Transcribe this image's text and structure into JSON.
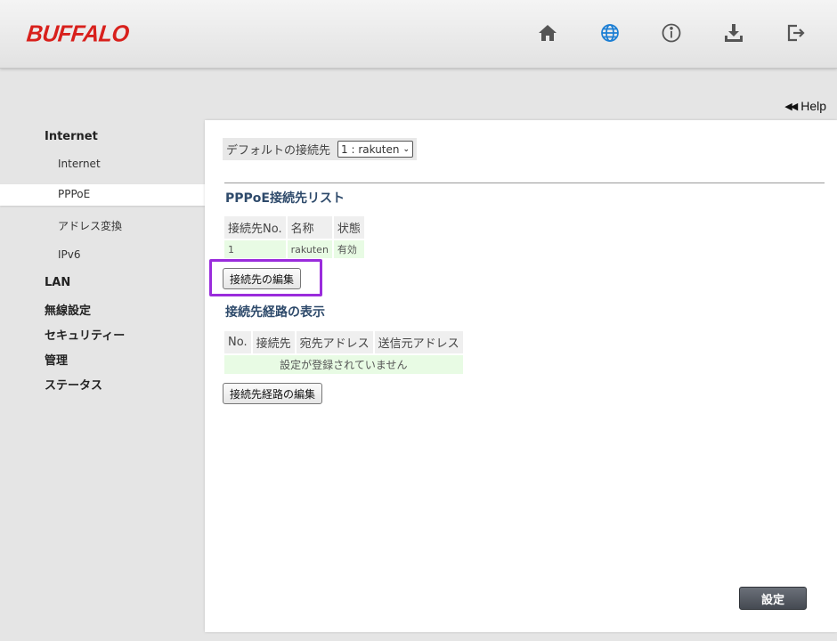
{
  "header": {
    "logo": "BUFFALO",
    "icons": [
      "home-icon",
      "globe-icon",
      "info-icon",
      "download-icon",
      "logout-icon"
    ]
  },
  "help": {
    "label": "Help"
  },
  "sidebar": {
    "sections": [
      {
        "label": "Internet",
        "items": [
          "Internet",
          "PPPoE",
          "アドレス変換",
          "IPv6"
        ]
      },
      {
        "label": "LAN"
      },
      {
        "label": "無線設定"
      },
      {
        "label": "セキュリティー"
      },
      {
        "label": "管理"
      },
      {
        "label": "ステータス"
      }
    ],
    "active_item": "PPPoE"
  },
  "main": {
    "default_label": "デフォルトの接続先",
    "default_value": "1 : rakuten",
    "pppoe_list_title": "PPPoE接続先リスト",
    "pppoe_table": {
      "headers": [
        "接続先No.",
        "名称",
        "状態"
      ],
      "rows": [
        [
          "1",
          "rakuten",
          "有効"
        ]
      ]
    },
    "edit_connection_button": "接続先の編集",
    "route_title": "接続先経路の表示",
    "route_table": {
      "headers": [
        "No.",
        "接続先",
        "宛先アドレス",
        "送信元アドレス"
      ],
      "empty_message": "設定が登録されていません"
    },
    "edit_route_button": "接続先経路の編集",
    "save_button": "設定"
  },
  "colors": {
    "brand": "#d8201c",
    "active_icon": "#1b7ed4",
    "highlight": "#9a2cdc",
    "table_cell": "#e8fbe4"
  }
}
